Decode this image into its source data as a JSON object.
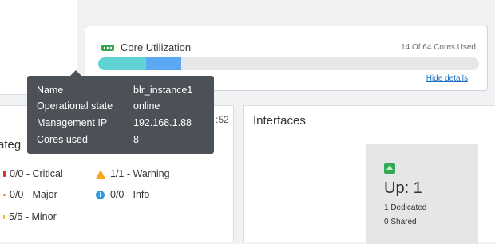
{
  "core_utilization": {
    "title": "Core Utilization",
    "used_text": "14 Of 64 Cores Used",
    "hide_details": "Hide details",
    "bar": {
      "total_cores": 64,
      "dedicated_fraction": 0.125,
      "shared_fraction": 0.094
    },
    "colors": {
      "dedicated": "#5fd3d3",
      "shared": "#5aa9f2",
      "track": "#e6e7e9",
      "icon": "#34a853"
    }
  },
  "tooltip": {
    "rows": [
      {
        "key": "Name",
        "value": "blr_instance1"
      },
      {
        "key": "Operational state",
        "value": "online"
      },
      {
        "key": "Management IP",
        "value": "192.168.1.88"
      },
      {
        "key": "Cores used",
        "value": "8"
      }
    ]
  },
  "alarms": {
    "title_fragment": "ateg",
    "timestamp_fragment": ":52",
    "items": [
      {
        "text": "0/0 - Critical",
        "icon": "critical-marker"
      },
      {
        "text": "1/1 - Warning",
        "icon": "warning-icon"
      },
      {
        "text": "0/0 - Major",
        "icon": "major-marker"
      },
      {
        "text": "0/0 - Info",
        "icon": "info-icon"
      },
      {
        "text": "5/5 - Minor",
        "icon": "minor-marker"
      }
    ]
  },
  "interfaces": {
    "title": "Interfaces",
    "up": {
      "label": "Up: 1",
      "dedicated": "1 Dedicated",
      "shared": "0 Shared"
    }
  }
}
